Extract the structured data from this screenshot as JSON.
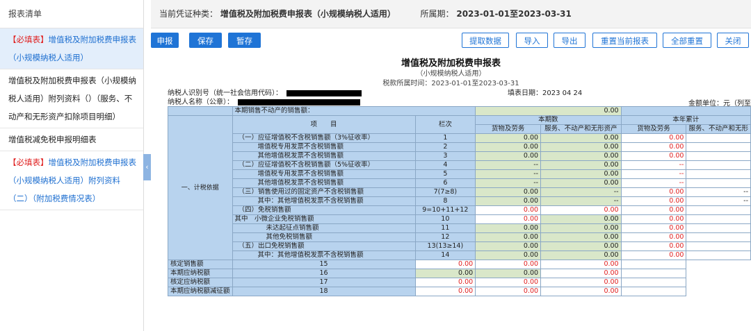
{
  "sidebar": {
    "header": "报表清单",
    "items": [
      {
        "req": "【必填表】",
        "text": "增值税及附加税费申报表（小规模纳税人适用）",
        "active": true
      },
      {
        "req": "",
        "text": "增值税及附加税费申报表（小规模纳税人适用）附列资料（）（服务、不动产和无形资产扣除项目明细）",
        "active": false
      },
      {
        "req": "",
        "text": "增值税减免税申报明细表",
        "active": false
      },
      {
        "req": "【必填表】",
        "text": "增值税及附加税费申报表（小规模纳税人适用）附列资料（二）（附加税费情况表）",
        "active": false
      }
    ],
    "collapse_glyph": "‹"
  },
  "voucher": {
    "label": "当前凭证种类：",
    "value": "增值税及附加税费申报表（小规模纳税人适用）",
    "period_label": "所属期：",
    "period_value": "2023-01-01至2023-03-31"
  },
  "toolbar": {
    "submit": "申报",
    "save": "保存",
    "temp_save": "暂存",
    "fetch": "提取数据",
    "import": "导入",
    "export": "导出",
    "reset_current": "重置当前报表",
    "reset_all": "全部重置",
    "close": "关闭"
  },
  "form": {
    "title": "增值税及附加税费申报表",
    "subtitle": "（小规模纳税人适用）",
    "period": "税款所属时间：2023-01-01至2023-03-31",
    "taxpayer_id_label": "纳税人识别号（统一社会信用代码）：",
    "taxpayer_name_label": "纳税人名称（公章）：",
    "fill_date": "填表日期：2023 04 24",
    "unit": "金额单位：元（列至"
  },
  "table": {
    "top_row_label": "本期销售不动产的销售额：",
    "top_row_value": "0.00",
    "header_item": "项　　目",
    "header_col": "栏次",
    "header_period": "本期数",
    "header_ytd": "本年累计",
    "sub_goods": "货物及劳务",
    "sub_services": "服务、不动产和无形资产",
    "sub_goods2": "货物及劳务",
    "sub_services2": "服务、不动产和无形",
    "side_label": "一、计税依据",
    "rows": [
      {
        "item": "（一）应征增值税不含税销售额（3%征收率）",
        "col": "1",
        "a": "0.00",
        "b": "0.00",
        "c": "0.00",
        "d": "",
        "indent": 1,
        "types": "ggw"
      },
      {
        "item": "增值税专用发票不含税销售额",
        "col": "2",
        "a": "0.00",
        "b": "0.00",
        "c": "0.00",
        "d": "",
        "indent": 2,
        "types": "ggw"
      },
      {
        "item": "其他增值税发票不含税销售额",
        "col": "3",
        "a": "0.00",
        "b": "0.00",
        "c": "0.00",
        "d": "",
        "indent": 2,
        "types": "ggw"
      },
      {
        "item": "（二）应征增值税不含税销售额（5%征收率）",
        "col": "4",
        "a": "--",
        "b": "0.00",
        "c": "--",
        "d": "",
        "indent": 1,
        "types": "ggw"
      },
      {
        "item": "增值税专用发票不含税销售额",
        "col": "5",
        "a": "--",
        "b": "0.00",
        "c": "--",
        "d": "",
        "indent": 2,
        "types": "ggw"
      },
      {
        "item": "其他增值税发票不含税销售额",
        "col": "6",
        "a": "--",
        "b": "0.00",
        "c": "--",
        "d": "",
        "indent": 2,
        "types": "ggw"
      },
      {
        "item": "（三）销售使用过的固定资产不含税销售额",
        "col": "7(7≥8)",
        "a": "0.00",
        "b": "--",
        "c": "0.00",
        "d": "--",
        "indent": 1,
        "types": "ggw"
      },
      {
        "item": "其中：其他增值税发票不含税销售额",
        "col": "8",
        "a": "0.00",
        "b": "--",
        "c": "0.00",
        "d": "--",
        "indent": 2,
        "types": "ggw"
      },
      {
        "item": "（四）免税销售额",
        "col": "9=10+11+12",
        "a": "0.00",
        "b": "0.00",
        "c": "0.00",
        "d": "",
        "indent": 1,
        "types": "www"
      },
      {
        "item": "其中　小微企业免税销售额",
        "col": "10",
        "a": "0.00",
        "b": "0.00",
        "c": "0.00",
        "d": "",
        "indent": 0,
        "types": "wgw"
      },
      {
        "item": "未达起征点销售额",
        "col": "11",
        "a": "0.00",
        "b": "0.00",
        "c": "0.00",
        "d": "",
        "indent": 3,
        "types": "ggw"
      },
      {
        "item": "其他免税销售额",
        "col": "12",
        "a": "0.00",
        "b": "0.00",
        "c": "0.00",
        "d": "",
        "indent": 3,
        "types": "ggw"
      },
      {
        "item": "（五）出口免税销售额",
        "col": "13(13≥14)",
        "a": "0.00",
        "b": "0.00",
        "c": "0.00",
        "d": "",
        "indent": 1,
        "types": "ggw"
      },
      {
        "item": "其中：其他增值税发票不含税销售额",
        "col": "14",
        "a": "0.00",
        "b": "0.00",
        "c": "0.00",
        "d": "",
        "indent": 2,
        "types": "ggw"
      },
      {
        "item": "核定销售额",
        "col": "15",
        "a": "0.00",
        "b": "0.00",
        "c": "0.00",
        "d": "",
        "indent": 0,
        "types": "www"
      },
      {
        "item": "本期应纳税额",
        "col": "16",
        "a": "0.00",
        "b": "0.00",
        "c": "0.00",
        "d": "",
        "indent": 0,
        "types": "ggw"
      },
      {
        "item": "核定应纳税额",
        "col": "17",
        "a": "0.00",
        "b": "0.00",
        "c": "0.00",
        "d": "",
        "indent": 0,
        "types": "www"
      },
      {
        "item": "本期应纳税额减征额",
        "col": "18",
        "a": "0.00",
        "b": "0.00",
        "c": "0.00",
        "d": "",
        "indent": 0,
        "types": "www"
      }
    ]
  }
}
